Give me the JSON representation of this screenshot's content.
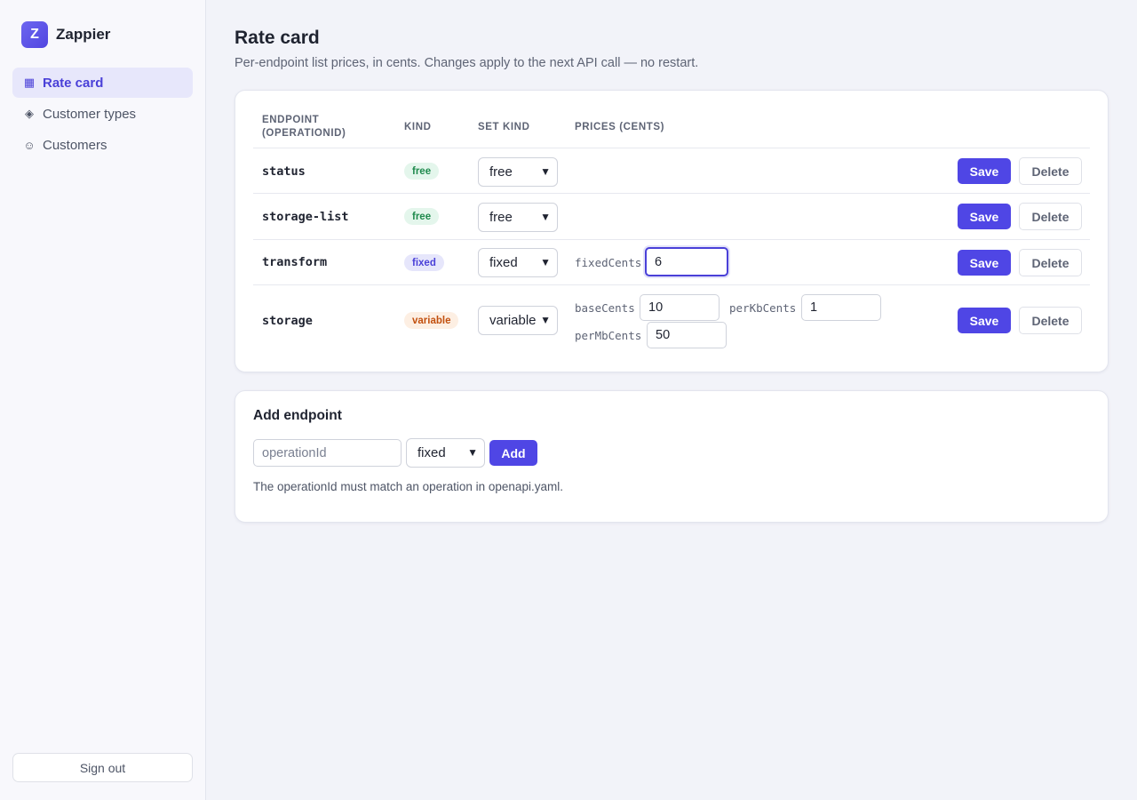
{
  "brand": {
    "logo_letter": "Z",
    "name": "Zappier"
  },
  "sidebar": {
    "items": [
      {
        "label": "Rate card",
        "icon": "grid-icon",
        "glyph": "▦",
        "active": true
      },
      {
        "label": "Customer types",
        "icon": "diamond-icon",
        "glyph": "◈",
        "active": false
      },
      {
        "label": "Customers",
        "icon": "smiley-icon",
        "glyph": "☺",
        "active": false
      }
    ],
    "sign_out": "Sign out"
  },
  "page": {
    "title": "Rate card",
    "subtitle": "Per-endpoint list prices, in cents. Changes apply to the next API call — no restart."
  },
  "table": {
    "headers": {
      "endpoint_line1": "ENDPOINT",
      "endpoint_line2": "(OPERATIONID)",
      "kind": "KIND",
      "set_kind": "SET KIND",
      "prices": "PRICES (CENTS)"
    },
    "save_label": "Save",
    "delete_label": "Delete",
    "rows": [
      {
        "name": "status",
        "kind": "free",
        "set_kind": "free"
      },
      {
        "name": "storage-list",
        "kind": "free",
        "set_kind": "free"
      },
      {
        "name": "transform",
        "kind": "fixed",
        "set_kind": "fixed",
        "fields": [
          {
            "label": "fixedCents",
            "value": "6",
            "focused": true
          }
        ]
      },
      {
        "name": "storage",
        "kind": "variable",
        "set_kind": "variable",
        "fields": [
          {
            "label": "baseCents",
            "value": "10"
          },
          {
            "label": "perKbCents",
            "value": "1"
          },
          {
            "label": "perMbCents",
            "value": "50"
          }
        ]
      }
    ]
  },
  "add_endpoint": {
    "title": "Add endpoint",
    "placeholder": "operationId",
    "kind_selected": "fixed",
    "add_label": "Add",
    "help": "The operationId must match an operation in openapi.yaml."
  },
  "colors": {
    "accent": "#4f46e5",
    "free": "#1f8a4d",
    "fixed": "#4a40d8",
    "variable": "#c2500f"
  }
}
